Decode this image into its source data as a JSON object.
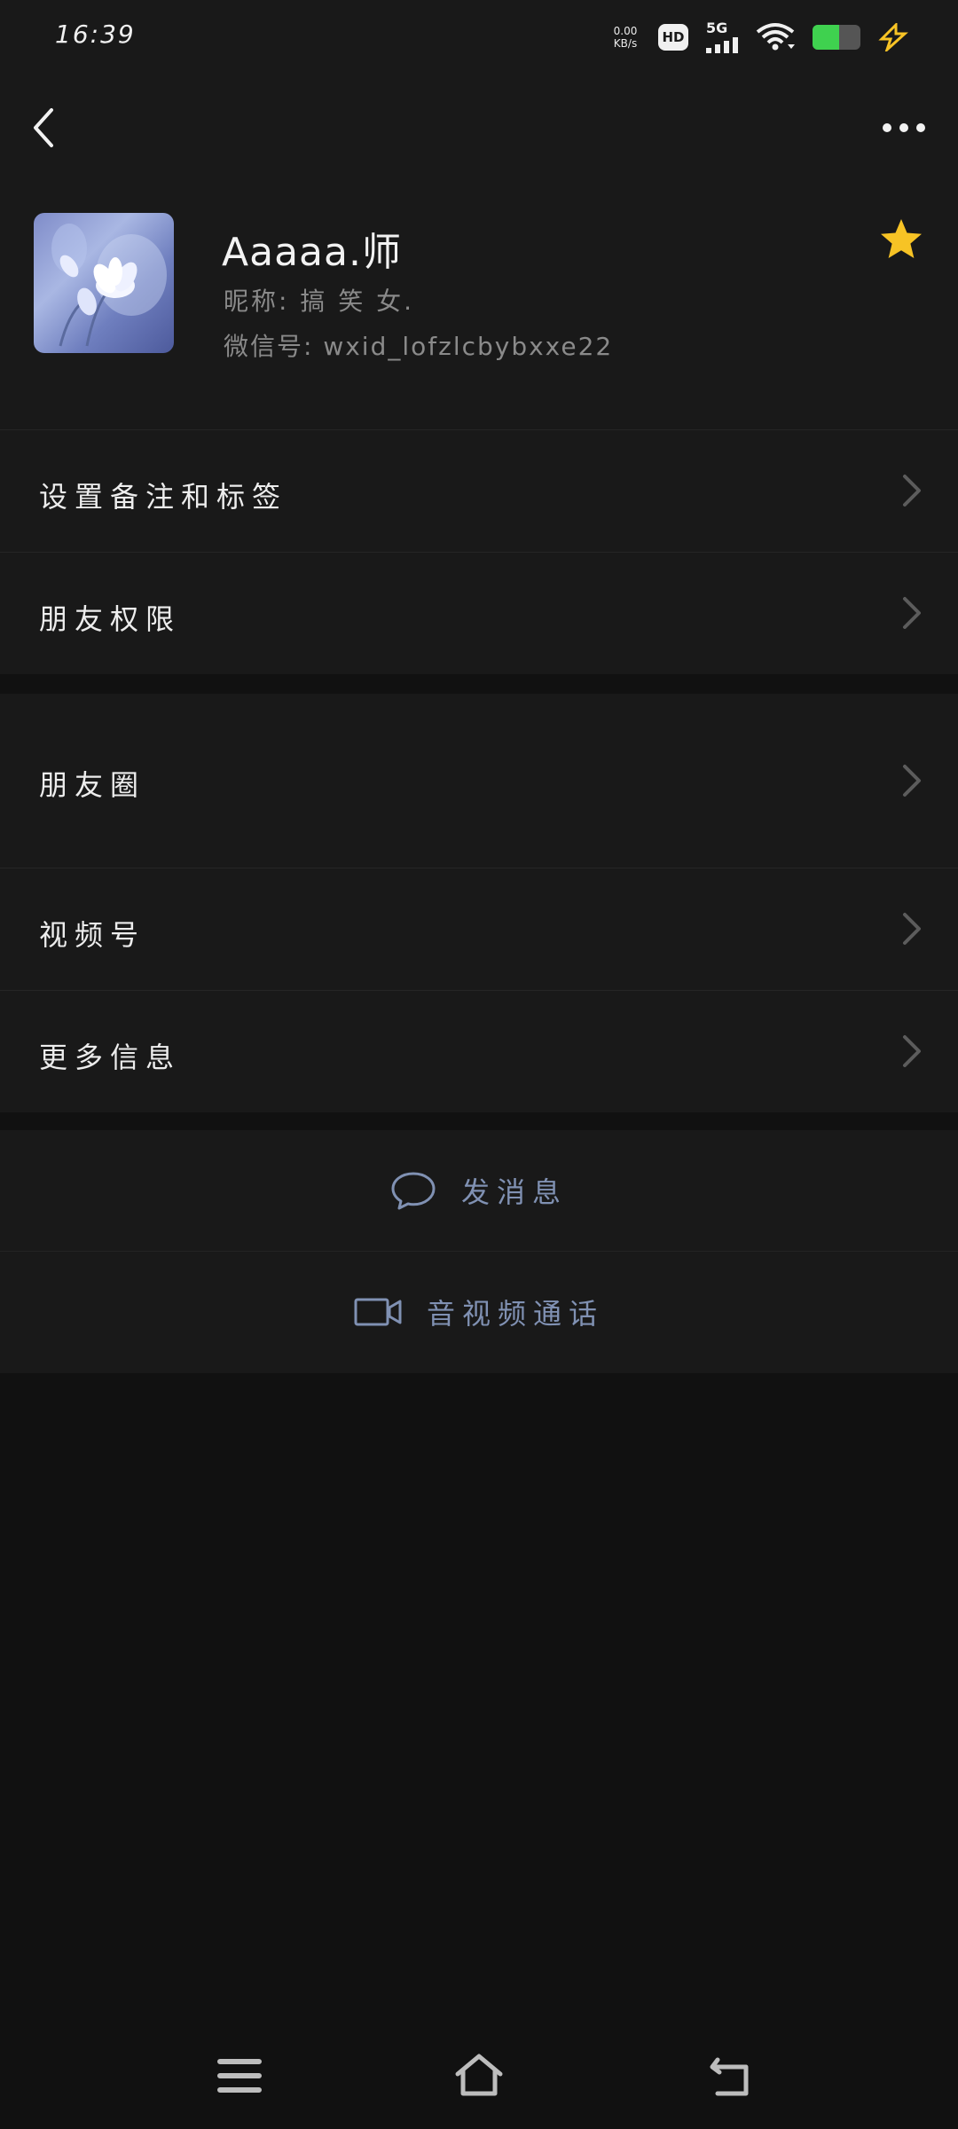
{
  "status_bar": {
    "time": "16:39",
    "net_speed_value": "0.00",
    "net_speed_unit": "KB/s",
    "hd_label": "HD",
    "network_label": "5G",
    "battery_level": 0.55,
    "icons": [
      "wifi-icon",
      "signal-icon",
      "battery-icon",
      "charging-icon"
    ]
  },
  "header": {
    "back_icon": "chevron-left-icon",
    "more_icon": "more-dots-icon"
  },
  "profile": {
    "name": "Aaaaa.师",
    "nickname": "昵称: 搞 笑 女.",
    "wechat_id": "微信号: wxid_lofzlcbybxxe22",
    "starred": true,
    "star_color": "#f7c325"
  },
  "menu_section_1": [
    {
      "label": "设置备注和标签"
    },
    {
      "label": "朋友权限"
    }
  ],
  "menu_section_2": [
    {
      "label": "朋友圈"
    },
    {
      "label": "视频号"
    },
    {
      "label": "更多信息"
    }
  ],
  "actions": {
    "send_message": "发消息",
    "video_call": "音视频通话",
    "accent_color": "#8091b3"
  },
  "nav_bar": {
    "icons": [
      "menu-icon",
      "home-icon",
      "return-icon"
    ]
  }
}
